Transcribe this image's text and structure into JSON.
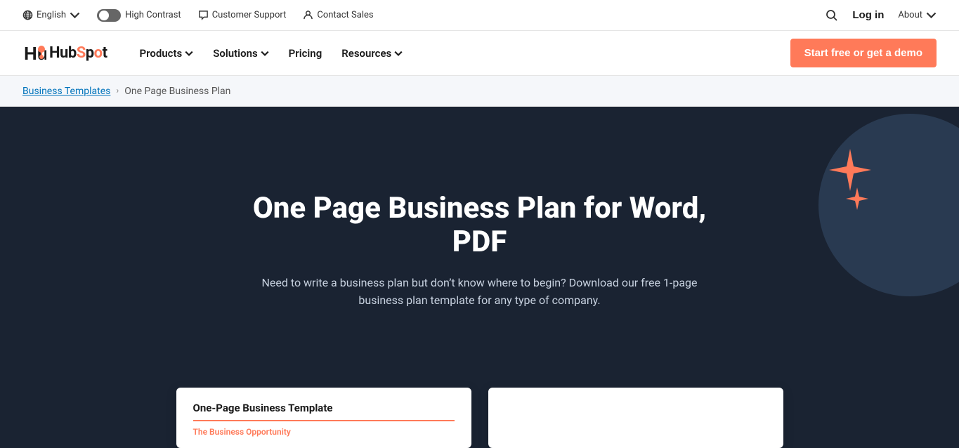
{
  "topbar": {
    "language_label": "English",
    "contrast_label": "High Contrast",
    "support_label": "Customer Support",
    "sales_label": "Contact Sales",
    "login_label": "Log in",
    "about_label": "About"
  },
  "nav": {
    "products_label": "Products",
    "solutions_label": "Solutions",
    "pricing_label": "Pricing",
    "resources_label": "Resources",
    "cta_label": "Start free or get a demo"
  },
  "breadcrumb": {
    "parent_label": "Business Templates",
    "current_label": "One Page Business Plan"
  },
  "hero": {
    "title": "One Page Business Plan for Word, PDF",
    "subtitle": "Need to write a business plan but don’t know where to begin? Download our free 1-page business plan template for any type of company."
  },
  "cards": [
    {
      "title": "One-Page Business Template",
      "subtitle": "The Business Opportunity"
    },
    {
      "title": "",
      "subtitle": ""
    }
  ]
}
